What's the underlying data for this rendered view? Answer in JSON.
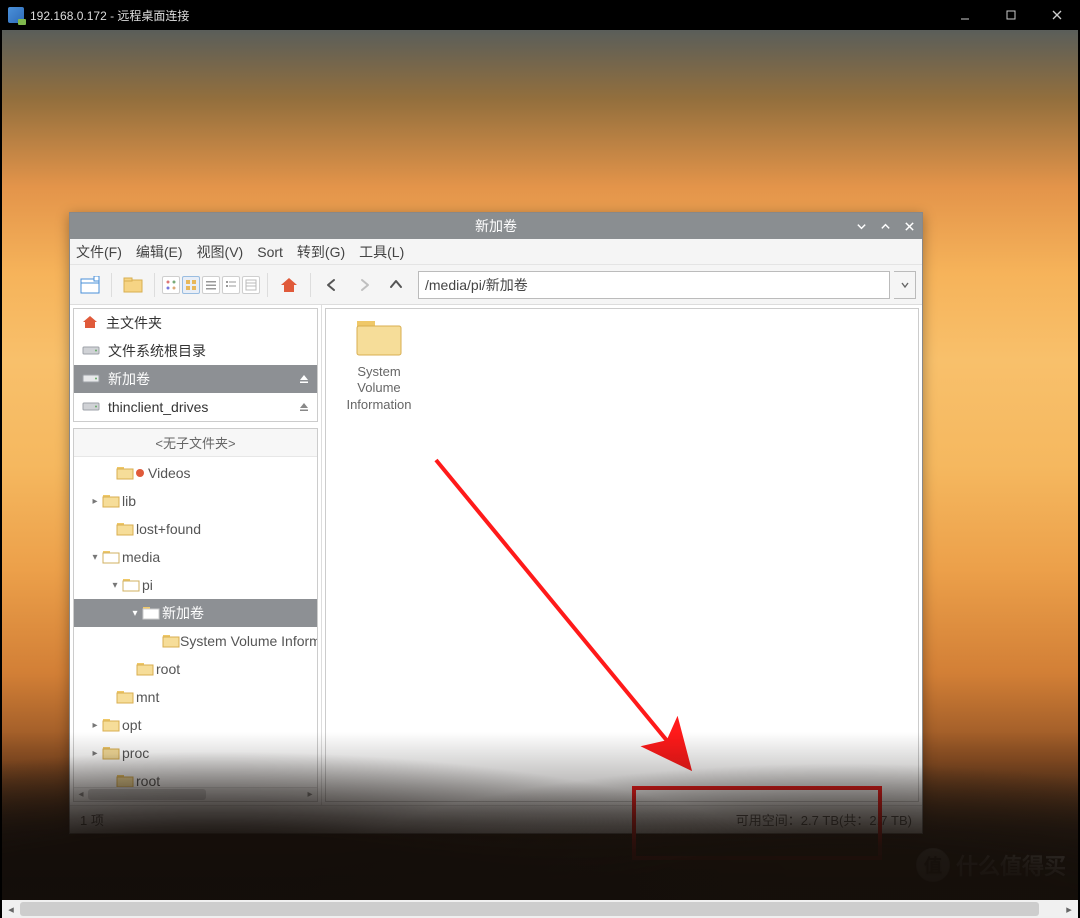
{
  "rdp": {
    "title": "192.168.0.172 - 远程桌面连接"
  },
  "fm": {
    "title": "新加卷",
    "menu": {
      "file": "文件(F)",
      "edit": "编辑(E)",
      "view": "视图(V)",
      "sort": "Sort",
      "goto": "转到(G)",
      "tools": "工具(L)"
    },
    "path": "/media/pi/新加卷"
  },
  "places": {
    "home": "主文件夹",
    "fsroot": "文件系统根目录",
    "xinjiajuan": "新加卷",
    "thinclient": "thinclient_drives"
  },
  "tree": {
    "header": "<无子文件夹>",
    "videos": "Videos",
    "lib": "lib",
    "lostfound": "lost+found",
    "media": "media",
    "pi": "pi",
    "xinjiajuan": "新加卷",
    "sysvol": "System Volume Informa",
    "root": "root",
    "mnt": "mnt",
    "opt": "opt",
    "proc": "proc",
    "root2": "root"
  },
  "content": {
    "item1": "System\nVolume\nInformation"
  },
  "status": {
    "left": "1 项",
    "right": "可用空间：2.7 TB(共：2.7 TB)"
  },
  "watermark": {
    "badge": "值",
    "text": "什么值得买"
  }
}
